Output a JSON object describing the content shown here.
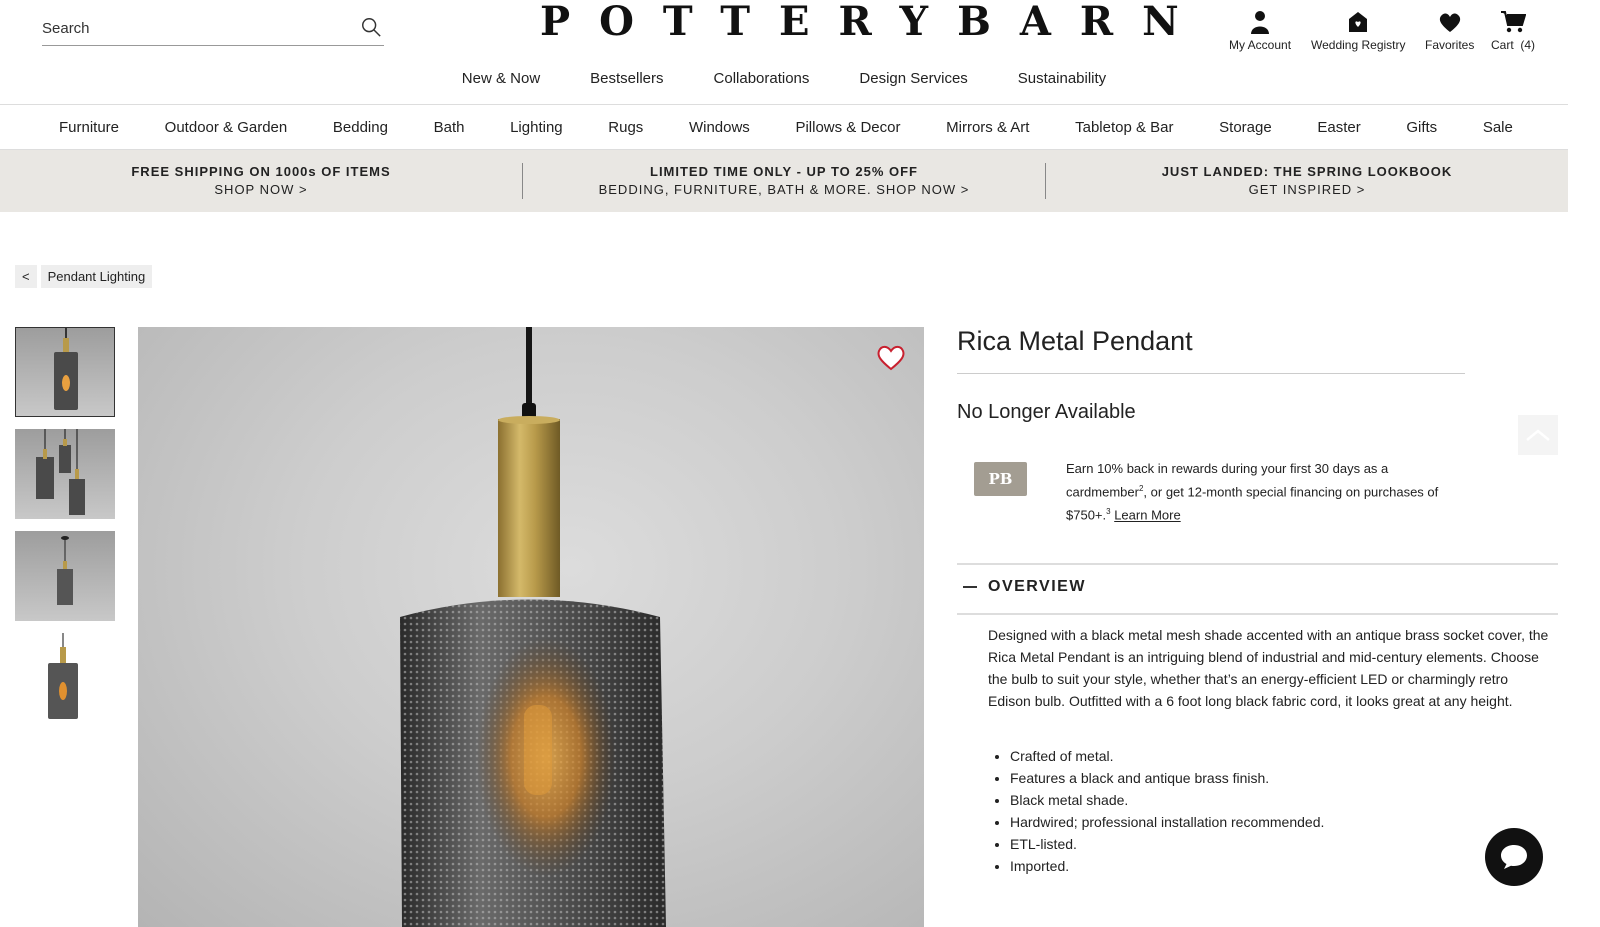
{
  "search": {
    "placeholder": "Search"
  },
  "logo": "POTTERYBARN",
  "account": [
    {
      "label": "My Account",
      "icon": "user-icon"
    },
    {
      "label": "Wedding Registry",
      "icon": "registry-icon"
    },
    {
      "label": "Favorites",
      "icon": "heart-icon"
    },
    {
      "label": "Cart  (4)",
      "icon": "cart-icon"
    }
  ],
  "topnav": [
    "New & Now",
    "Bestsellers",
    "Collaborations",
    "Design Services",
    "Sustainability"
  ],
  "categories": [
    "Furniture",
    "Outdoor & Garden",
    "Bedding",
    "Bath",
    "Lighting",
    "Rugs",
    "Windows",
    "Pillows & Decor",
    "Mirrors & Art",
    "Tabletop & Bar",
    "Storage",
    "Easter",
    "Gifts",
    "Sale"
  ],
  "promos": [
    {
      "headline": "FREE SHIPPING ON 1000s OF ITEMS",
      "cta": "SHOP NOW >"
    },
    {
      "headline": "LIMITED TIME ONLY - UP TO 25% OFF",
      "cta": "BEDDING, FURNITURE, BATH & MORE. SHOP NOW >"
    },
    {
      "headline": "JUST LANDED: THE SPRING LOOKBOOK",
      "cta": "GET INSPIRED >"
    }
  ],
  "breadcrumb": {
    "back": "<",
    "label": "Pendant Lighting"
  },
  "product": {
    "title": "Rica Metal Pendant",
    "status": "No Longer Available",
    "card_logo": "PB",
    "rewards_a": "Earn 10% back in rewards during your first 30 days as a cardmember",
    "rewards_sup1": "2",
    "rewards_b": ", or get 12-month special financing on purchases of $750+.",
    "rewards_sup2": "3",
    "learn_more": "Learn More"
  },
  "overview": {
    "heading": "OVERVIEW",
    "description": "Designed with a black metal mesh shade accented with an antique brass socket cover, the Rica Metal Pendant is an intriguing blend of industrial and mid-century elements. Choose the bulb to suit your style, whether that’s an energy-efficient LED or charmingly retro Edison bulb. Outfitted with a 6 foot long black fabric cord, it looks great at any height.",
    "bullets": [
      "Crafted of metal.",
      "Features a black and antique brass finish.",
      "Black metal shade.",
      "Hardwired; professional installation recommended.",
      "ETL-listed.",
      "Imported."
    ]
  },
  "colors": {
    "promo_bg": "#e9e7e3",
    "card_bg": "#a39d92",
    "heart": "#c8202f"
  }
}
